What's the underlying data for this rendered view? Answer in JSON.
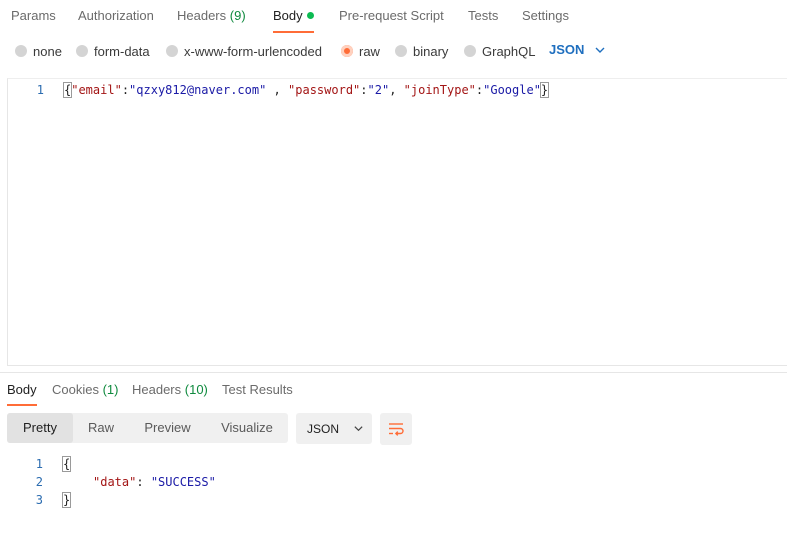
{
  "request_tabs": {
    "params": "Params",
    "authorization": "Authorization",
    "headers_label": "Headers",
    "headers_count": "(9)",
    "body": "Body",
    "pre_request": "Pre-request Script",
    "tests": "Tests",
    "settings": "Settings"
  },
  "body_types": {
    "none": "none",
    "form_data": "form-data",
    "urlencoded": "x-www-form-urlencoded",
    "raw": "raw",
    "binary": "binary",
    "graphql": "GraphQL",
    "selected": "raw",
    "language": "JSON"
  },
  "request_body": {
    "line_number": "1",
    "open_brace": "{",
    "email_key": "\"email\"",
    "email_value": "\"qzxy812@naver.com\"",
    "password_key": "\"password\"",
    "password_value": "\"2\"",
    "jointype_key": "\"joinType\"",
    "jointype_value": "\"Google\"",
    "close_brace": "}"
  },
  "response_tabs": {
    "body": "Body",
    "cookies_label": "Cookies",
    "cookies_count": "(1)",
    "headers_label": "Headers",
    "headers_count": "(10)",
    "test_results": "Test Results"
  },
  "response_view": {
    "pretty": "Pretty",
    "raw": "Raw",
    "preview": "Preview",
    "visualize": "Visualize",
    "format": "JSON"
  },
  "response_body": {
    "line_numbers": [
      "1",
      "2",
      "3"
    ],
    "open_brace": "{",
    "data_key": "\"data\"",
    "data_value": "\"SUCCESS\"",
    "close_brace": "}"
  },
  "colors": {
    "accent": "#ff6c37",
    "link_blue": "#1f6fbf",
    "status_green": "#0cbb52"
  }
}
